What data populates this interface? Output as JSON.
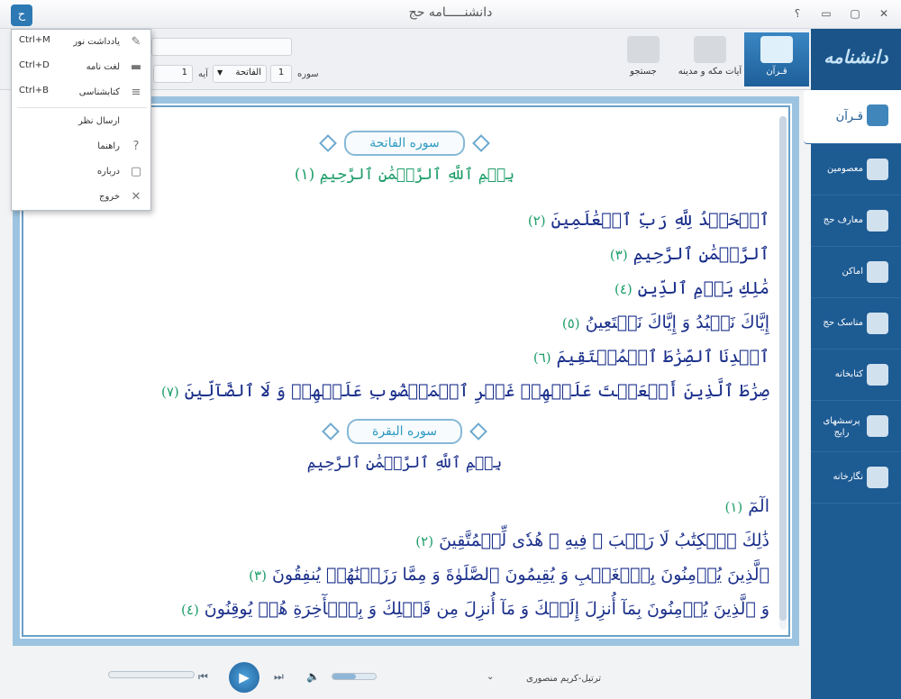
{
  "window": {
    "title": "دانشنـــــامه حج",
    "buttons": [
      "؟",
      "▭",
      "▢",
      "✕"
    ]
  },
  "toolbar": {
    "buttons": [
      {
        "label": "قـرآن",
        "active": true
      },
      {
        "label": "آیات مکه و مدینه",
        "active": false
      },
      {
        "label": "جستجو",
        "active": false
      }
    ],
    "sura_label": "سوره",
    "sura_number": "1",
    "sura_select": "الفاتحة",
    "aye_label": "آیه",
    "aye_number": "1"
  },
  "menu": {
    "items": [
      {
        "label": "یادداشت نور",
        "shortcut": "Ctrl+M",
        "icon": "note-icon"
      },
      {
        "label": "لغت نامه",
        "shortcut": "Ctrl+D",
        "icon": "book-icon"
      },
      {
        "label": "کتابشناسی",
        "shortcut": "Ctrl+B",
        "icon": "books-icon"
      },
      {
        "label": "ارسال نظر",
        "shortcut": "",
        "icon": ""
      },
      {
        "label": "راهنما",
        "shortcut": "",
        "icon": "help-icon"
      },
      {
        "label": "درباره",
        "shortcut": "",
        "icon": "info-icon"
      },
      {
        "label": "خروج",
        "shortcut": "",
        "icon": "close-icon"
      }
    ]
  },
  "sidebar": {
    "logo": "دانشنامه حج",
    "items": [
      {
        "label": "قـرآن",
        "active": true
      },
      {
        "label": "معصومین",
        "active": false
      },
      {
        "label": "معارف حج",
        "active": false
      },
      {
        "label": "اماکن",
        "active": false
      },
      {
        "label": "مناسک حج",
        "active": false
      },
      {
        "label": "کتابخانه",
        "active": false
      },
      {
        "label": "پرسشهای رایج",
        "active": false
      },
      {
        "label": "نگارخانه",
        "active": false
      }
    ]
  },
  "quran": {
    "sura1_title": "سوره الفاتحة",
    "sura1_bismillah": "بِسۡمِ ٱللَّهِ ٱلرَّحۡمَٰنِ ٱلرَّحِيمِ",
    "sura1_bismillah_num": "(١)",
    "sura1_verses": [
      {
        "text": "ٱلۡحَمۡدُ لِلَّهِ رَبِّ ٱلۡعَٰلَمِينَ",
        "num": "(٢)"
      },
      {
        "text": "ٱلرَّحۡمَٰنِ ٱلرَّحِيمِ",
        "num": "(٣)"
      },
      {
        "text": "مَٰلِكِ يَوۡمِ ٱلدِّينِ",
        "num": "(٤)"
      },
      {
        "text": "إِيَّاكَ نَعۡبُدُ وَ إِيَّاكَ نَسۡتَعِينُ",
        "num": "(٥)"
      },
      {
        "text": "ٱهۡدِنَا ٱلصِّرَٰطَ ٱلۡمُسۡتَقِيمَ",
        "num": "(٦)"
      },
      {
        "text": "صِرَٰطَ ٱلَّذِينَ أَنۡعَمۡتَ عَلَيۡهِمۡ غَيۡرِ ٱلۡمَغۡضُوبِ عَلَيۡهِمۡ وَ لَا ٱلضَّآلِّينَ",
        "num": "(٧)"
      }
    ],
    "sura2_title": "سوره البقرة",
    "sura2_bismillah": "بِسۡمِ ٱللَّهِ ٱلرَّحۡمَٰنِ ٱلرَّحِيمِ",
    "sura2_verses": [
      {
        "text": "الٓمٓ",
        "num": "(١)"
      },
      {
        "text": "ذَٰلِكَ ٱلۡكِتَٰبُ لَا رَيۡبَ ۛ فِيهِ ۛ هُدٗى لِّلۡمُتَّقِينَ",
        "num": "(٢)"
      },
      {
        "text": "ٱلَّذِينَ يُؤۡمِنُونَ بِٱلۡغَيۡبِ وَ يُقِيمُونَ ٱلصَّلَوٰةَ وَ مِمَّا رَزَقۡنَٰهُمۡ يُنفِقُونَ",
        "num": "(٣)"
      },
      {
        "text": "وَ ٱلَّذِينَ يُؤۡمِنُونَ بِمَآ أُنزِلَ إِلَيۡكَ وَ مَآ أُنزِلَ مِن قَبۡلِكَ وَ بِٱلۡأٓخِرَةِ هُمۡ يُوقِنُونَ",
        "num": "(٤)"
      }
    ]
  },
  "player": {
    "reciter": "ترتیل-کریم منصوری",
    "volume_fraction": 0.55
  }
}
